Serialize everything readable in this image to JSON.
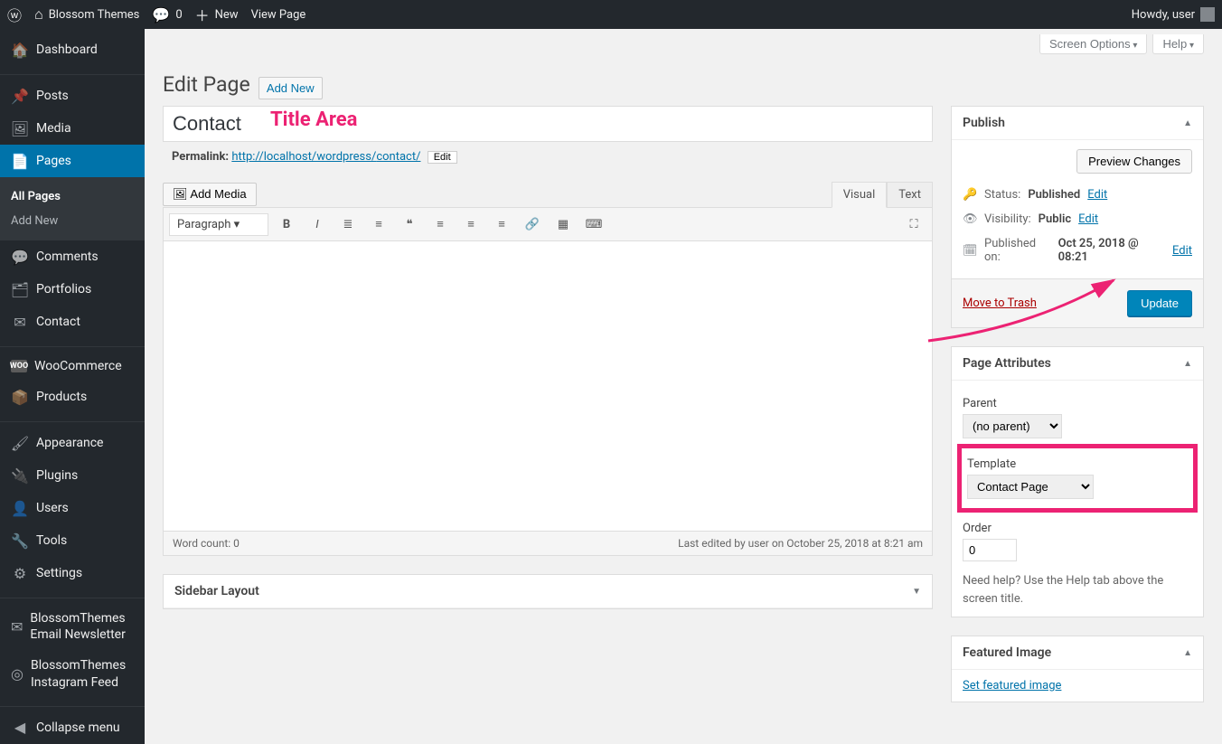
{
  "adminBar": {
    "siteName": "Blossom Themes",
    "commentCount": "0",
    "newLabel": "New",
    "viewPage": "View Page",
    "howdy": "Howdy, user"
  },
  "sidebar": {
    "items": [
      {
        "icon": "⌂",
        "label": "Dashboard"
      },
      {
        "icon": "📌",
        "label": "Posts"
      },
      {
        "icon": "🖼",
        "label": "Media"
      },
      {
        "icon": "📄",
        "label": "Pages",
        "active": true
      },
      {
        "icon": "💬",
        "label": "Comments"
      },
      {
        "icon": "🗂",
        "label": "Portfolios"
      },
      {
        "icon": "✉",
        "label": "Contact"
      },
      {
        "icon": "W",
        "label": "WooCommerce"
      },
      {
        "icon": "📦",
        "label": "Products"
      },
      {
        "icon": "🖌",
        "label": "Appearance"
      },
      {
        "icon": "🔌",
        "label": "Plugins"
      },
      {
        "icon": "👤",
        "label": "Users"
      },
      {
        "icon": "🔧",
        "label": "Tools"
      },
      {
        "icon": "⚙",
        "label": "Settings"
      },
      {
        "icon": "✉",
        "label": "BlossomThemes Email Newsletter"
      },
      {
        "icon": "◎",
        "label": "BlossomThemes Instagram Feed"
      },
      {
        "icon": "◀",
        "label": "Collapse menu"
      }
    ],
    "submenu": [
      "All Pages",
      "Add New"
    ]
  },
  "header": {
    "title": "Edit Page",
    "addNew": "Add New",
    "screenOptions": "Screen Options",
    "help": "Help"
  },
  "editor": {
    "titleValue": "Contact",
    "titleAnnotation": "Title Area",
    "permalinkLabel": "Permalink:",
    "permalinkBase": "http://localhost/wordpress/",
    "permalinkSlug": "contact/",
    "permalinkEdit": "Edit",
    "addMedia": "Add Media",
    "tabVisual": "Visual",
    "tabText": "Text",
    "formatSelect": "Paragraph",
    "wordCountLabel": "Word count: 0",
    "lastEdited": "Last edited by user on October 25, 2018 at 8:21 am",
    "sidebarLayoutTitle": "Sidebar Layout"
  },
  "publish": {
    "title": "Publish",
    "previewBtn": "Preview Changes",
    "statusLabel": "Status:",
    "statusValue": "Published",
    "visibilityLabel": "Visibility:",
    "visibilityValue": "Public",
    "publishedLabel": "Published on:",
    "publishedValue": "Oct 25, 2018 @ 08:21",
    "editLink": "Edit",
    "trash": "Move to Trash",
    "updateBtn": "Update"
  },
  "attributes": {
    "title": "Page Attributes",
    "parentLabel": "Parent",
    "parentValue": "(no parent)",
    "templateLabel": "Template",
    "templateValue": "Contact Page",
    "orderLabel": "Order",
    "orderValue": "0",
    "help": "Need help? Use the Help tab above the screen title."
  },
  "featured": {
    "title": "Featured Image",
    "link": "Set featured image"
  }
}
